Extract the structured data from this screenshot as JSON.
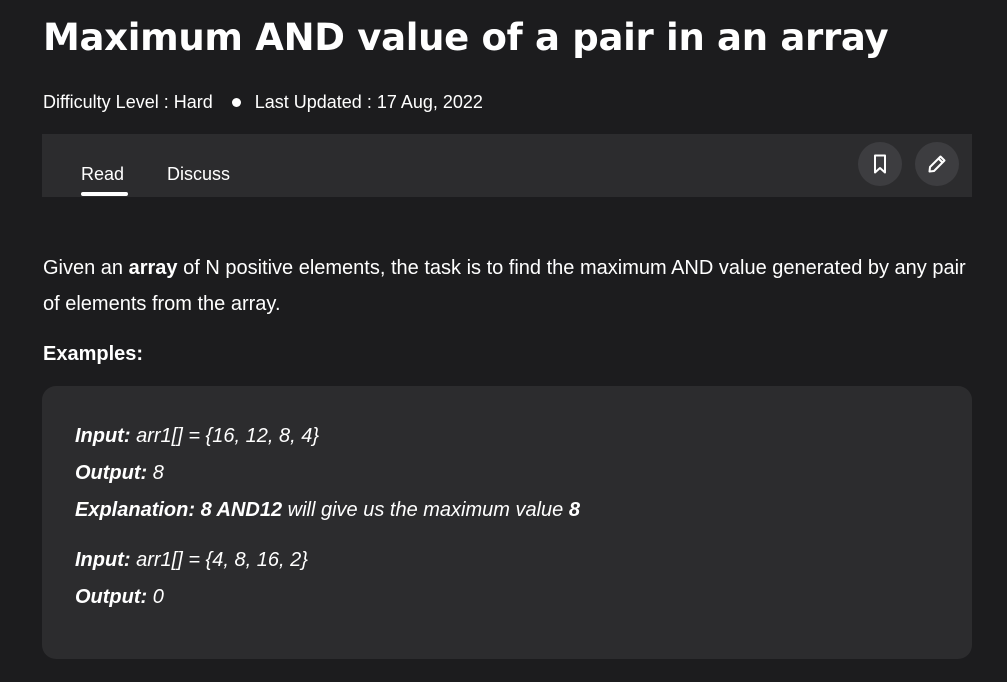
{
  "article": {
    "title": "Maximum AND value of a pair in an array",
    "difficulty": "Difficulty Level : Hard",
    "last_updated": "Last Updated : 17 Aug, 2022"
  },
  "tabs": {
    "read": "Read",
    "discuss": "Discuss",
    "active": "Read"
  },
  "actions": {
    "bookmark_icon": "bookmark-icon",
    "edit_icon": "pencil-icon"
  },
  "content": {
    "intro_before": "Given an ",
    "intro_bold": "array",
    "intro_after": " of N positive elements, the task is to find the maximum AND value generated by any pair of elements from the array.",
    "examples_heading": "Examples:"
  },
  "examples": [
    {
      "input_label": "Input:",
      "input_value": " arr1[] = {16, 12, 8, 4}",
      "output_label": "Output:",
      "output_value": " 8",
      "explanation_label": "Explanation: 8 AND12",
      "explanation_text": " will give us the maximum value ",
      "explanation_value": "8"
    },
    {
      "input_label": "Input:",
      "input_value": " arr1[] = {4, 8, 16, 2}",
      "output_label": "Output:",
      "output_value": " 0"
    }
  ],
  "colors": {
    "background": "#1c1c1e",
    "panel": "#2c2c2e",
    "icon_button": "#3d3d40",
    "text": "#ffffff"
  }
}
